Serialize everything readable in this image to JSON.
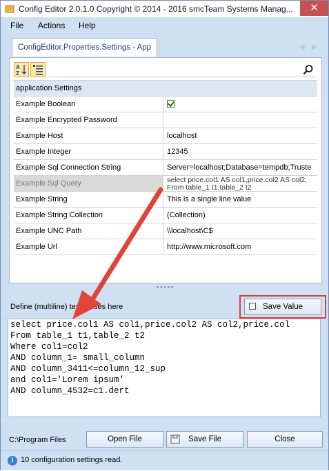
{
  "window": {
    "title": "Config Editor 2.0.1.0 Copyright © 2014 - 2016 smcTeam Systems Manag...",
    "close_glyph": "✕"
  },
  "menu": [
    "File",
    "Actions",
    "Help"
  ],
  "tabs": [
    {
      "label": "ConfigEditor.Properties.Settings - App"
    }
  ],
  "property_grid": {
    "category": "application Settings",
    "rows": [
      {
        "name": "Example Boolean",
        "value": "",
        "type": "checkbox",
        "checked": true
      },
      {
        "name": "Example Encrypted Password",
        "value": ""
      },
      {
        "name": "Example Host",
        "value": "localhost"
      },
      {
        "name": "Example Integer",
        "value": "12345"
      },
      {
        "name": "Example Sql Connection String",
        "value": "Server=localhost;Database=tempdb;Truste"
      },
      {
        "name": "Example Sql Query",
        "value_line1": "select price.col1 AS col1,price.col2 AS col2,",
        "value_line2": "From table_1 t1,table_2 t2",
        "selected": true
      },
      {
        "name": "Example String",
        "value": "This is a single line value"
      },
      {
        "name": "Example String Collection",
        "value": "(Collection)"
      },
      {
        "name": "Example UNC Path",
        "value": "\\\\localhost\\C$"
      },
      {
        "name": "Example Url",
        "value": "http://www.microsoft.com"
      }
    ]
  },
  "editor": {
    "label": "Define (multiline) text values here",
    "save_value_label": "Save Value",
    "lines": [
      "select price.col1 AS col1,price.col2 AS col2,price.col",
      "From table_1 t1,table_2 t2",
      "Where col1=col2",
      "AND column_1= small_column",
      "AND column_3411<=column_12_sup",
      "and col1='Lorem ipsum'",
      "AND column_4532=c1.dert"
    ]
  },
  "footer": {
    "path": "C:\\Program Files",
    "open_file_label": "Open File",
    "save_file_label": "Save File",
    "close_label": "Close"
  },
  "status": {
    "text": "10 configuration settings read."
  },
  "colors": {
    "window_bg": "#cfe0f3",
    "annotation_red": "#e03a3a"
  }
}
